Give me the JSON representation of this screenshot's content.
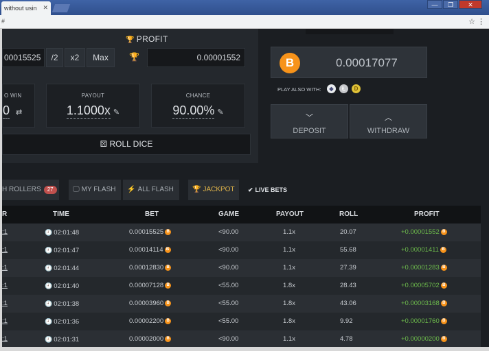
{
  "browser": {
    "tab_title": "without usin",
    "tab_close": "✕",
    "address": "#",
    "star": "☆",
    "menu": "⋮",
    "win_min": "—",
    "win_max": "❐",
    "win_close": "✕"
  },
  "bet": {
    "profit_label": "PROFIT",
    "bet_amount": "00015525",
    "half_label": "/2",
    "double_label": "x2",
    "max_label": "Max",
    "profit_value": "0.00001552",
    "to_win_label": "O WIN",
    "to_win_value": "0",
    "payout_label": "PAYOUT",
    "payout_value": "1.1000x",
    "chance_label": "CHANCE",
    "chance_value": "90.00%",
    "roll_label": "ROLL DICE"
  },
  "wallet": {
    "balance": "0.00017077",
    "play_also_label": "PLAY ALSO WITH:",
    "deposit_label": "DEPOSIT",
    "withdraw_label": "WITHDRAW"
  },
  "tabs": [
    {
      "label": "H ROLLERS",
      "badge": "27"
    },
    {
      "label": "MY FLASH"
    },
    {
      "label": "ALL FLASH"
    },
    {
      "label": "JACKPOT"
    },
    {
      "label": "LIVE BETS"
    }
  ],
  "table": {
    "headers": {
      "user": "R",
      "time": "TIME",
      "bet": "BET",
      "game": "GAME",
      "payout": "PAYOUT",
      "roll": "ROLL",
      "profit": "PROFIT"
    },
    "rows": [
      {
        "user": ":1",
        "time": "02:01:48",
        "bet": "0.00015525",
        "game": "<90.00",
        "payout": "1.1x",
        "roll": "20.07",
        "profit": "+0.00001552"
      },
      {
        "user": ":1",
        "time": "02:01:47",
        "bet": "0.00014114",
        "game": "<90.00",
        "payout": "1.1x",
        "roll": "55.68",
        "profit": "+0.00001411"
      },
      {
        "user": ":1",
        "time": "02:01:44",
        "bet": "0.00012830",
        "game": "<90.00",
        "payout": "1.1x",
        "roll": "27.39",
        "profit": "+0.00001283"
      },
      {
        "user": ":1",
        "time": "02:01:40",
        "bet": "0.00007128",
        "game": "<55.00",
        "payout": "1.8x",
        "roll": "28.43",
        "profit": "+0.00005702"
      },
      {
        "user": ":1",
        "time": "02:01:38",
        "bet": "0.00003960",
        "game": "<55.00",
        "payout": "1.8x",
        "roll": "43.06",
        "profit": "+0.00003168"
      },
      {
        "user": ":1",
        "time": "02:01:36",
        "bet": "0.00002200",
        "game": "<55.00",
        "payout": "1.8x",
        "roll": "9.92",
        "profit": "+0.00001760"
      },
      {
        "user": ":1",
        "time": "02:01:31",
        "bet": "0.00002000",
        "game": "<90.00",
        "payout": "1.1x",
        "roll": "4.78",
        "profit": "+0.00000200"
      }
    ]
  },
  "icons": {
    "btc_symbol": "B",
    "eth_symbol": "◆",
    "ltc_symbol": "Ł",
    "doge_symbol": "D",
    "trophy": "🏆",
    "pencil": "✎",
    "dice": "⚄",
    "exchange": "⇄",
    "chevron_down": "﹀",
    "chevron_up": "︿",
    "check": "✔",
    "clock": "🕘",
    "monitor": "🖵",
    "flash": "⚡"
  },
  "colors": {
    "accent_btc": "#f7931a",
    "profit_green": "#6dbb4c",
    "badge_red": "#c0504d"
  }
}
